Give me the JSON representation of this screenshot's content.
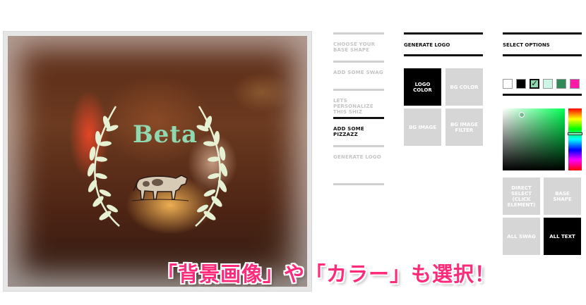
{
  "preview": {
    "logo_text": "Beta"
  },
  "steps": [
    {
      "label": "CHOOSE YOUR BASE SHAPE",
      "active": false
    },
    {
      "label": "ADD SOME SWAG",
      "active": false
    },
    {
      "label": "LETS PERSONALIZE THIS SHIZ",
      "active": false
    },
    {
      "label": "ADD SOME PIZZAZZ",
      "active": true
    },
    {
      "label": "GENERATE LOGO",
      "active": false
    }
  ],
  "generate": {
    "header": "GENERATE LOGO",
    "tiles": [
      {
        "label": "LOGO COLOR",
        "selected": true
      },
      {
        "label": "BG COLOR",
        "selected": false
      },
      {
        "label": "BG IMAGE",
        "selected": false
      },
      {
        "label": "BG IMAGE FILTER",
        "selected": false
      }
    ]
  },
  "options": {
    "header": "SELECT OPTIONS",
    "swatches": [
      {
        "color": "#ffffff",
        "selected": false
      },
      {
        "color": "#000000",
        "selected": false
      },
      {
        "color": "#8fd9b0",
        "selected": true,
        "mark": "✓"
      },
      {
        "color": "#ccf5e6",
        "selected": false
      },
      {
        "color": "#2e8b57",
        "selected": false
      },
      {
        "color": "#ff1aa8",
        "selected": false
      }
    ],
    "select_tiles": [
      {
        "label": "DIRECT SELECT (CLICK ELEMENT)",
        "selected": false
      },
      {
        "label": "BASE SHAPE",
        "selected": false
      },
      {
        "label": "ALL SWAG",
        "selected": false
      },
      {
        "label": "ALL TEXT",
        "selected": true
      }
    ]
  },
  "caption": "「背景画像」や「カラー」も選択！"
}
